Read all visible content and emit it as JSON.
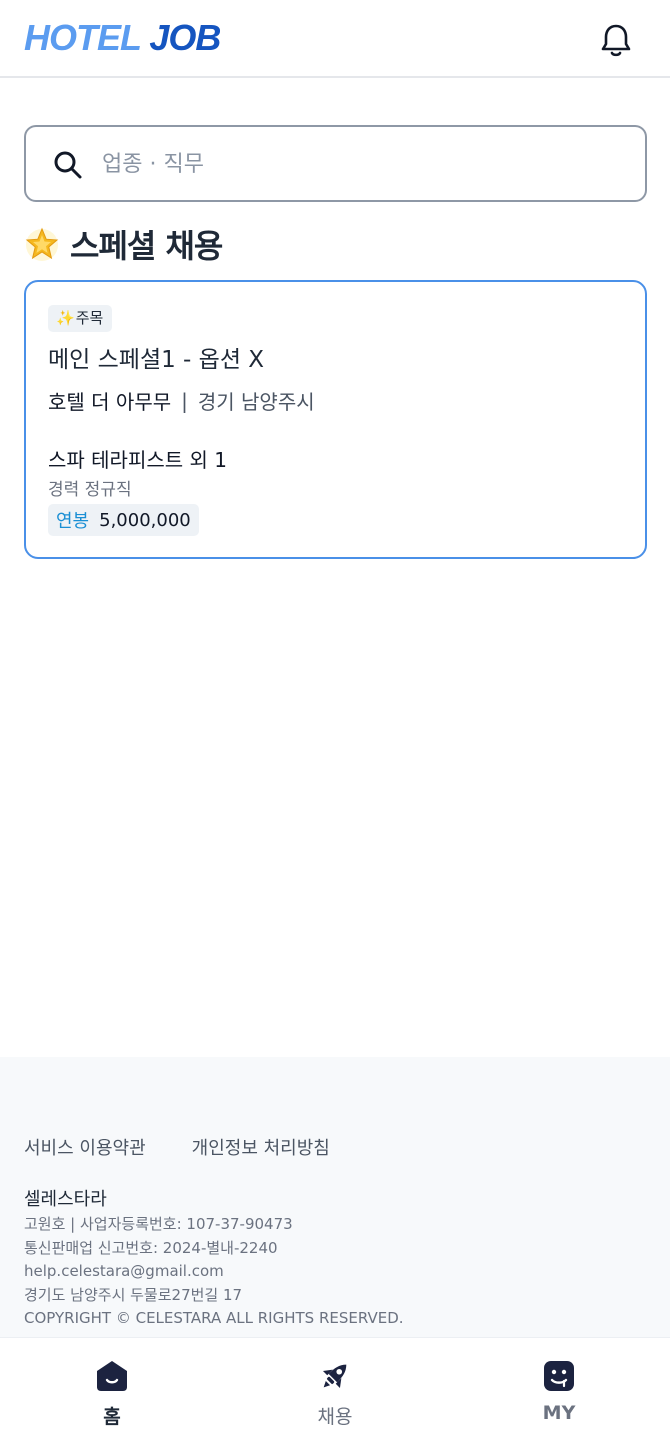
{
  "header": {
    "logo_part1": "HOTEL",
    "logo_part2": "JOB",
    "notification_icon": "bell-icon"
  },
  "search": {
    "placeholder": "업종 · 직무",
    "value": "",
    "icon": "search-icon"
  },
  "special_section": {
    "icon": "glowing-star-icon",
    "title": "스페셜 채용",
    "cards": [
      {
        "badge_icon": "sparkles-icon",
        "badge_label": "주목",
        "title": "메인 스페셜1 - 옵션 X",
        "company": "호텔 더 아무무",
        "separator": "|",
        "location": "경기 남양주시",
        "job_title": "스파 테라피스트 외 1",
        "job_meta": "경력 정규직",
        "salary_label": "연봉",
        "salary_value": "5,000,000"
      }
    ]
  },
  "footer": {
    "terms_link": "서비스 이용약관",
    "privacy_link": "개인정보 처리방침",
    "company_name": "셀레스타라",
    "info_lines": [
      "고원호 | 사업자등록번호: 107-37-90473",
      "통신판매업 신고번호: 2024-별내-2240",
      "help.celestara@gmail.com",
      "경기도 남양주시 두물로27번길 17",
      "COPYRIGHT © CELESTARA ALL RIGHTS RESERVED."
    ]
  },
  "bottom_nav": {
    "items": [
      {
        "label": "홈",
        "icon": "home-icon",
        "active": true
      },
      {
        "label": "채용",
        "icon": "rocket-icon",
        "active": false
      },
      {
        "label": "MY",
        "icon": "my-face-icon",
        "active": false
      }
    ]
  },
  "colors": {
    "logo_light": "#5b9cf0",
    "logo_dark": "#1555c0",
    "card_border": "#4a90e8",
    "salary_label": "#1a8fd4",
    "nav_icon_dark": "#1c2340"
  }
}
